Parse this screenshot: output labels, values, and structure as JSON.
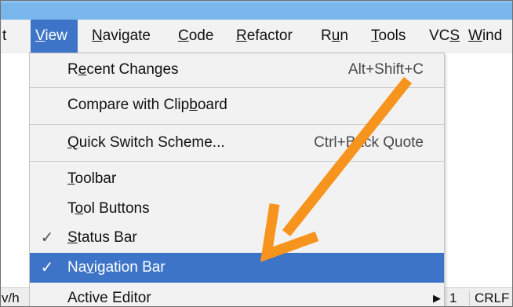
{
  "menubar": {
    "items": [
      {
        "text": "t",
        "mnemonic": ""
      },
      {
        "text": "View",
        "mnemonic": "V"
      },
      {
        "text": "Navigate",
        "mnemonic": "N"
      },
      {
        "text": "Code",
        "mnemonic": "C"
      },
      {
        "text": "Refactor",
        "mnemonic": "R"
      },
      {
        "text": "Run",
        "mnemonic": "u"
      },
      {
        "text": "Tools",
        "mnemonic": "T"
      },
      {
        "text": "VCS",
        "mnemonic": "S"
      },
      {
        "text": "Wind",
        "mnemonic": "W"
      }
    ],
    "active_index": 1
  },
  "view_menu": {
    "recent_changes": {
      "pre": "R",
      "mn": "e",
      "post": "cent Changes",
      "shortcut": "Alt+Shift+C"
    },
    "compare_with_clipboard": {
      "pre": "Compare with Clip",
      "mn": "b",
      "post": "oard"
    },
    "quick_switch_scheme": {
      "pre": "",
      "mn": "Q",
      "post": "uick Switch Scheme...",
      "shortcut": "Ctrl+Back Quote"
    },
    "toolbar": {
      "pre": "",
      "mn": "T",
      "post": "oolbar"
    },
    "tool_buttons": {
      "pre": "T",
      "mn": "o",
      "post": "ol Buttons"
    },
    "status_bar": {
      "pre": "",
      "mn": "S",
      "post": "tatus Bar",
      "checked": true
    },
    "navigation_bar": {
      "pre": "Na",
      "mn": "v",
      "post": "igation Bar",
      "checked": true
    },
    "active_editor": {
      "pre": "Active Editor",
      "mn": "",
      "post": ""
    },
    "check_glyph": "✓",
    "submenu_glyph": "▶"
  },
  "statusbar": {
    "left_fragment": "v/h",
    "line_fragment": "1",
    "line_separator": "CRLF"
  },
  "colors": {
    "title_bar": "#79b6ec",
    "selection": "#3d74c8",
    "menu_bg": "#f2f2f2",
    "annotation_arrow": "#f7941d"
  },
  "annotation": {
    "icon": "arrow-pointing-to-navigation-bar"
  }
}
